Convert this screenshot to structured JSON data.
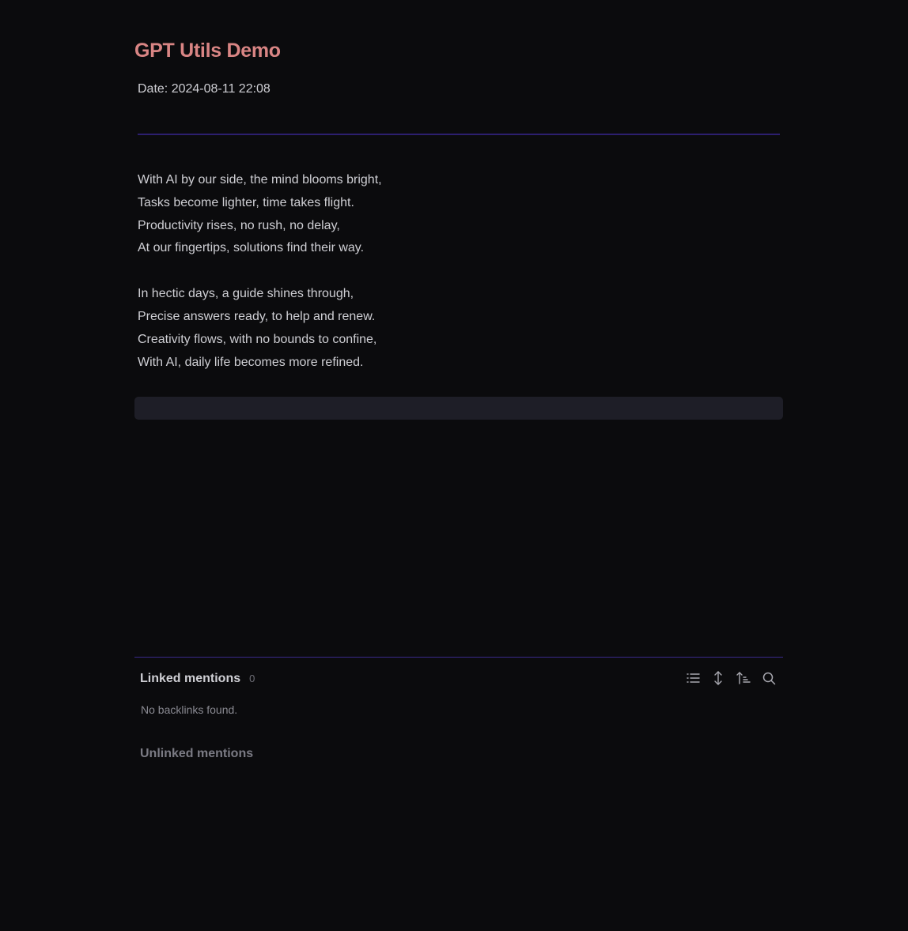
{
  "note": {
    "title": "GPT Utils Demo",
    "date_line": "Date: 2024-08-11 22:08",
    "stanzas": [
      [
        "With AI by our side, the mind blooms bright,",
        "Tasks become lighter, time takes flight.",
        "Productivity rises, no rush, no delay,",
        "At our fingertips, solutions find their way."
      ],
      [
        "In hectic days, a guide shines through,",
        "Precise answers ready, to help and renew.",
        "Creativity flows, with no bounds to confine,",
        "With AI, daily life becomes more refined."
      ]
    ]
  },
  "backlinks": {
    "linked_title": "Linked mentions",
    "linked_count": "0",
    "empty_message": "No backlinks found.",
    "unlinked_title": "Unlinked mentions",
    "toolbar_icons": [
      "list-icon",
      "expand-vertical-icon",
      "sort-ascending-icon",
      "search-icon"
    ]
  },
  "colors": {
    "background": "#0b0b0d",
    "title": "#d98584",
    "text": "#cfcfd4",
    "accent_rule": "#2c1f6e",
    "empty_block": "#1e1e27",
    "muted": "#7b7b84"
  }
}
